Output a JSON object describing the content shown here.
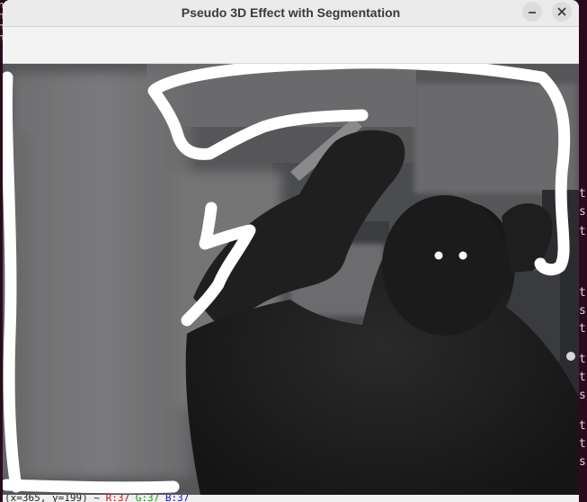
{
  "window": {
    "title": "Pseudo 3D Effect with Segmentation"
  },
  "terminal": {
    "left_lines": [
      "n",
      "n",
      "n",
      "n"
    ],
    "right_lines": [
      "th",
      "s,",
      "th",
      "th",
      "s,",
      "th",
      "th",
      "th",
      "s,",
      "th",
      "th",
      "s,"
    ]
  },
  "status": {
    "coords": "(x=365, y=199) ~",
    "r": "R:37",
    "g": "G:37",
    "b": "B:37"
  },
  "colors": {
    "terminal_bg": "#2c0a1e",
    "titlebar_bg": "#ebebeb",
    "canvas_bg": "#5a5a5c",
    "stroke": "#ffffff",
    "silhouette": "#1c1c1c"
  }
}
